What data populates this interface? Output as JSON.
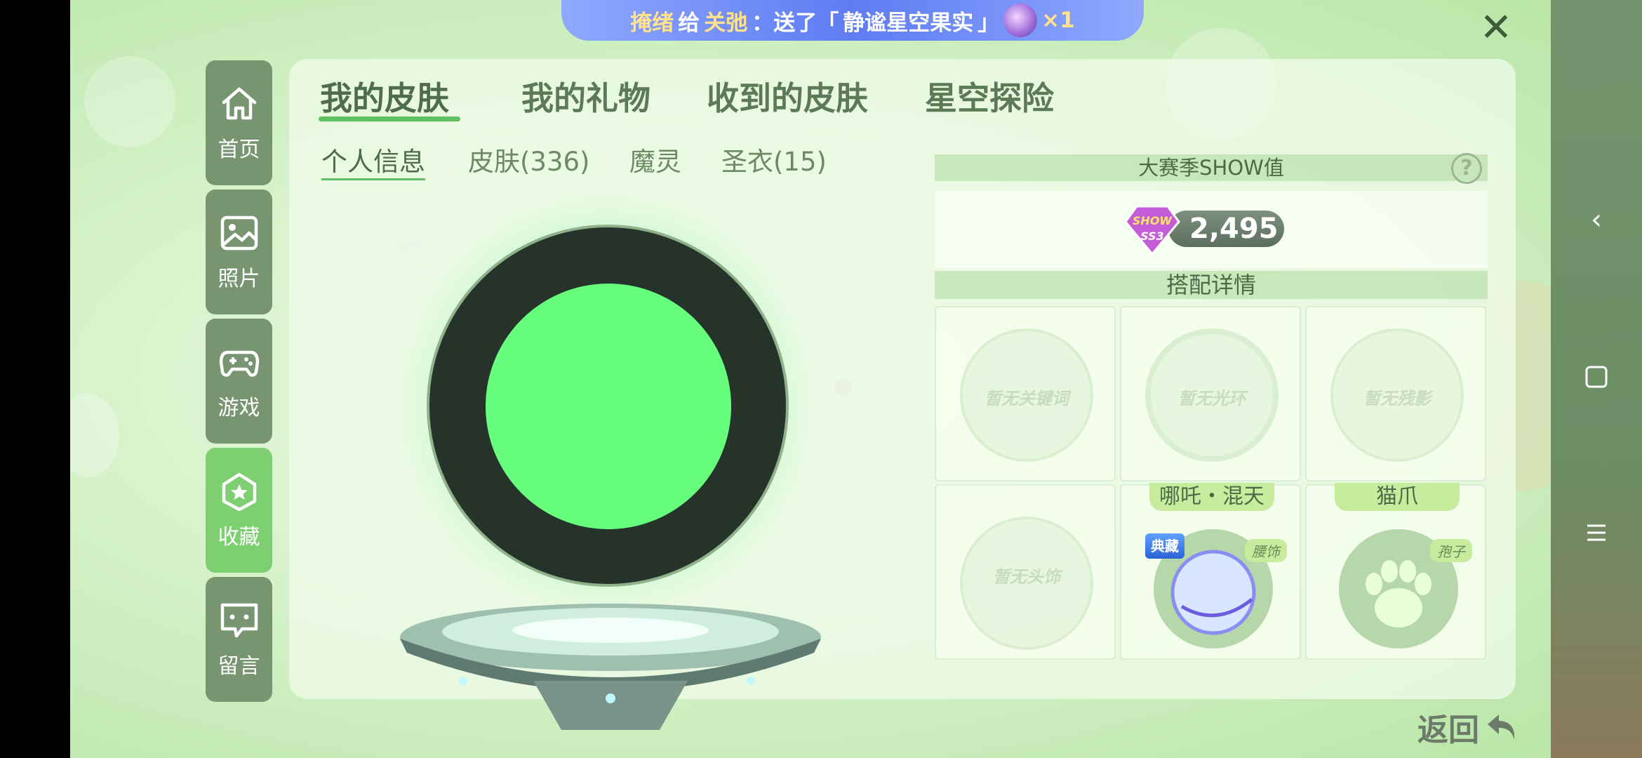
{
  "banner": {
    "sender": "掩绪",
    "verb": "给",
    "receiver": "关弛",
    "action": "：送了「",
    "gift": "静谧星空果实",
    "close_quote": "」",
    "count": "×1"
  },
  "sidebar": {
    "items": [
      {
        "label": "首页",
        "icon": "home-icon"
      },
      {
        "label": "照片",
        "icon": "photo-icon"
      },
      {
        "label": "游戏",
        "icon": "gamepad-icon"
      },
      {
        "label": "收藏",
        "icon": "star-badge-icon",
        "active": true
      },
      {
        "label": "留言",
        "icon": "message-icon"
      }
    ]
  },
  "tabs": {
    "items": [
      "我的皮肤",
      "我的礼物",
      "收到的皮肤",
      "星空探险"
    ],
    "active": "我的皮肤"
  },
  "subtabs": {
    "items": [
      "个人信息",
      "皮肤(336)",
      "魔灵",
      "圣衣(15)"
    ],
    "active": "个人信息"
  },
  "show": {
    "title": "大赛季SHOW值",
    "badge_text": "SHOW",
    "season": "SS3",
    "value": "2,495",
    "help": "?"
  },
  "outfit": {
    "title": "搭配详情",
    "slots": [
      {
        "empty_text": "暂无关键词"
      },
      {
        "empty_text": "暂无光环"
      },
      {
        "empty_text": "暂无残影"
      },
      {
        "empty_text": "暂无头饰"
      },
      {
        "title": "哪吒・混天",
        "tag": "腰饰",
        "badge": "典藏"
      },
      {
        "title": "猫爪",
        "tag": "孢子"
      }
    ]
  },
  "back_label": "返回",
  "colors": {
    "accent_green": "#5ec061",
    "avatar_core": "#67fe7e",
    "sidebar_item": "#779570",
    "sidebar_active": "#7dcf72"
  }
}
